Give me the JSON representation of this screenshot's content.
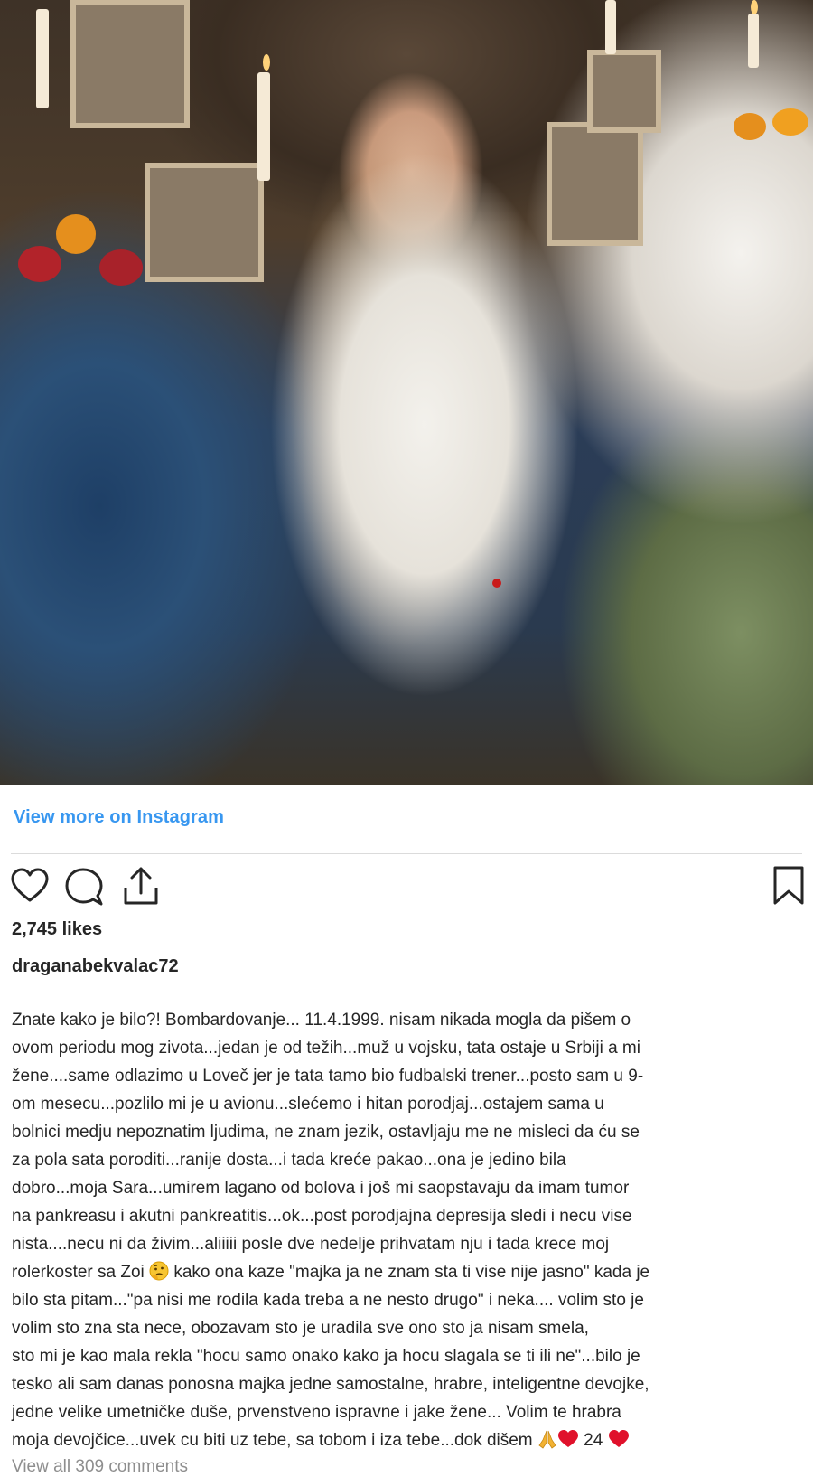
{
  "post": {
    "view_more_label": "View more on Instagram",
    "likes": "2,745 likes",
    "username": "draganabekvalac72",
    "caption_lines": [
      "Znate kako je bilo?! Bombardovanje... 11.4.1999. nisam nikada mogla da pišem o",
      "ovom periodu mog zivota...jedan je od težih...muž u vojsku, tata ostaje u Srbiji a mi",
      "žene....same odlazimo u Loveč jer je tata tamo bio fudbalski trener...posto sam u 9-",
      "om mesecu...pozlilo mi je u avionu...slećemo i hitan porodjaj...ostajem sama u",
      "bolnici medju nepoznatim ljudima, ne znam jezik, ostavljaju me ne misleci da ću se",
      "za pola sata poroditi...ranije dosta...i tada kreće pakao...ona je jedino bila",
      "dobro...moja Sara...umirem lagano od bolova i još mi saopstavaju da imam tumor",
      "na pankreasu i akutni pankreatitis...ok...post porodjajna depresija sledi i necu vise",
      "nista....necu ni da živim...aliiiii posle dve nedelje prihvatam nju i tada krece moj",
      "rolerkoster sa Zoi",
      "volim sto zna sta nece, obozavam sto je uradila sve ono sto ja nisam smela,",
      "sto mi je kao mala rekla \"hocu samo onako kako ja hocu slagala se ti ili ne\"...bilo je",
      "tesko ali sam danas ponosna majka jedne samostalne, hrabre, inteligentne devojke,",
      "jedne velike umetničke duše, prvenstveno ispravne i jake žene... Volim te hrabra",
      "moja devojčice...uvek cu biti uz tebe, sa tobom i iza tebe...dok dišem"
    ],
    "caption_line10_after_emoji": " kako ona kaze \"majka ja ne znam sta ti vise nije jasno\" kada je",
    "caption_line11": "bilo sta pitam...\"pa nisi me rodila kada treba a ne nesto drugo\" i neka.... volim sto je",
    "caption_tail_count": " 24 ",
    "view_all_comments": "View all 309 comments"
  },
  "icons": {
    "like": "heart-icon",
    "comment": "comment-bubble-icon",
    "share": "share-icon",
    "save": "bookmark-icon"
  },
  "colors": {
    "link": "#3897f0",
    "heart_emoji": "#e0112b",
    "divider": "#dbdbdb"
  }
}
